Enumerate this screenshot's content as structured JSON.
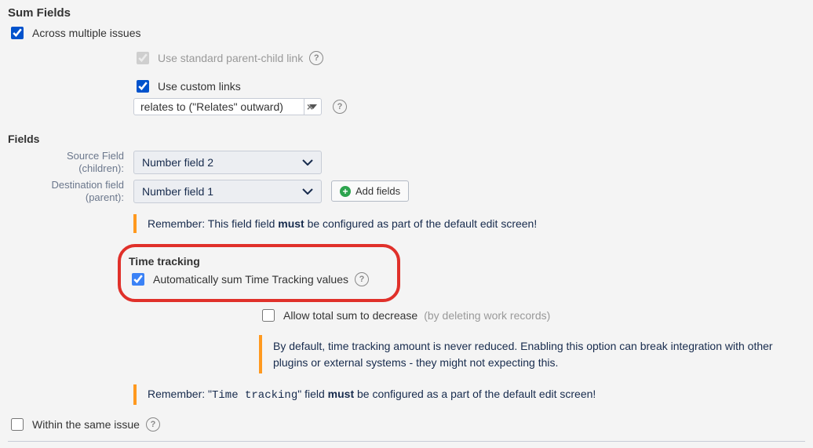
{
  "title": "Sum Fields",
  "acrossMultiple": {
    "label": "Across multiple issues",
    "checked": true
  },
  "parentChild": {
    "label": "Use standard parent-child link",
    "checked": true,
    "disabled": true
  },
  "customLinks": {
    "label": "Use custom links",
    "checked": true,
    "selected": "relates to (\"Relates\" outward)"
  },
  "fieldsHeading": "Fields",
  "sourceField": {
    "label1": "Source Field",
    "label2": "(children):",
    "value": "Number field 2"
  },
  "destField": {
    "label1": "Destination field",
    "label2": "(parent):",
    "value": "Number field 1"
  },
  "addFields": "Add fields",
  "note1": {
    "pre": "Remember: This field field ",
    "bold": "must",
    "post": " be configured as part of the default edit screen!"
  },
  "timeTracking": {
    "heading": "Time tracking",
    "auto": {
      "label": "Automatically sum Time Tracking values",
      "checked": true
    },
    "allowDecrease": {
      "label": "Allow total sum to decrease",
      "suffix": " (by deleting work records)",
      "checked": false
    },
    "explain": "By default, time tracking amount is never reduced. Enabling this option can break integration with other plugins or external systems - they might not expecting this."
  },
  "note2": {
    "pre": "Remember: \"",
    "code": "Time tracking",
    "mid": "\" field ",
    "bold": "must",
    "post": " be configured as a part of the default edit screen!"
  },
  "sameIssue": {
    "label": "Within the same issue",
    "checked": false
  }
}
